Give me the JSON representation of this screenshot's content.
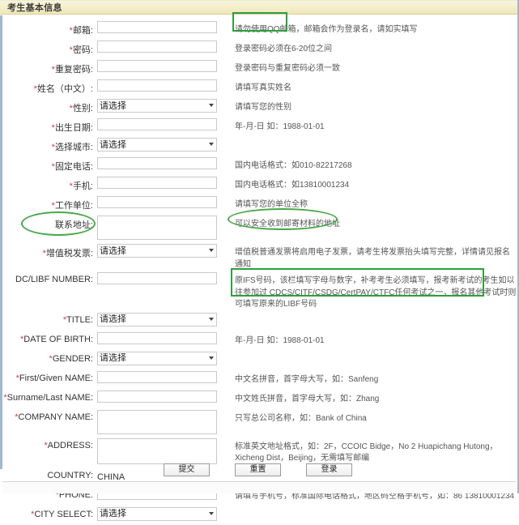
{
  "panel": {
    "title": "考生基本信息"
  },
  "placeholder_select": "请选择",
  "colors": {
    "annotation_green": "#2f9e3f",
    "header_bg": "#f4eec9",
    "required_star": "#d04040"
  },
  "fields": [
    {
      "label": "*邮箱:",
      "required": true,
      "type": "text",
      "value": "",
      "hint": "请勿使用QQ邮箱，邮箱会作为登录名，请如实填写",
      "hint_highlight": "box"
    },
    {
      "label": "*密码:",
      "required": true,
      "type": "text",
      "value": "",
      "hint": "登录密码必须在6-20位之间"
    },
    {
      "label": "*重复密码:",
      "required": true,
      "type": "text",
      "value": "",
      "hint": "登录密码与重复密码必须一致"
    },
    {
      "label": "*姓名（中文）:",
      "required": true,
      "type": "text",
      "value": "",
      "hint": "请填写真实姓名"
    },
    {
      "label": "*性别:",
      "required": true,
      "type": "select",
      "value": "请选择",
      "hint": "请填写您的性别"
    },
    {
      "label": "*出生日期:",
      "required": true,
      "type": "text",
      "value": "",
      "hint": "年-月-日 如：1988-01-01"
    },
    {
      "label": "*选择城市:",
      "required": true,
      "type": "select",
      "value": "请选择",
      "hint": ""
    },
    {
      "label": "*固定电话:",
      "required": true,
      "type": "text",
      "value": "",
      "hint": "国内电话格式：如010-82217268"
    },
    {
      "label": "*手机:",
      "required": true,
      "type": "text",
      "value": "",
      "hint": "国内电话格式：如13810001234"
    },
    {
      "label": "*工作单位:",
      "required": true,
      "type": "text",
      "value": "",
      "hint": "请填写您的单位全称"
    },
    {
      "label": "联系地址:",
      "required": false,
      "type": "textarea",
      "value": "",
      "hint": "可以安全收到邮寄材料的地址",
      "label_highlight": "ellipse",
      "hint_highlight": "ellipse"
    },
    {
      "label": "*增值税发票:",
      "required": true,
      "type": "select",
      "value": "请选择",
      "hint": "增值税普通发票将启用电子发票，请考生将发票抬头填写完整，详情请见报名通知"
    },
    {
      "label": "DC/LIBF NUMBER:",
      "required": false,
      "type": "text",
      "value": "",
      "hint": "原IFS号码，该栏填写字母与数字，补考考生必须填写，报考新考试的考生如以往参加过 CDCS/CITF/CSDG/CertPAY/CTFC任何考试之一，报名其他考试时则可填写原来的LIBF号码",
      "hint_highlight": "box"
    },
    {
      "label": "*TITLE:",
      "required": true,
      "type": "select",
      "value": "请选择",
      "hint": ""
    },
    {
      "label": "*DATE OF BIRTH:",
      "required": true,
      "type": "text",
      "value": "",
      "hint": "年-月-日 如：1988-01-01"
    },
    {
      "label": "*GENDER:",
      "required": true,
      "type": "select",
      "value": "请选择",
      "hint": ""
    },
    {
      "label": "*First/Given NAME:",
      "required": true,
      "type": "text",
      "value": "",
      "hint": "中文名拼音，首字母大写，如：Sanfeng"
    },
    {
      "label": "*Surname/Last NAME:",
      "required": true,
      "type": "text",
      "value": "",
      "hint": "中文姓氏拼音，首字母大写，如：Zhang"
    },
    {
      "label": "*COMPANY NAME:",
      "required": true,
      "type": "textarea",
      "value": "",
      "hint": "只写总公司名称，如：Bank of China"
    },
    {
      "label": "*ADDRESS:",
      "required": true,
      "type": "textarea",
      "value": "",
      "hint": "标准英文地址格式，如：2F，CCOIC Bidge，No 2 Huapichang Hutong，Xicheng Dist，Beijing，无需填写邮编"
    },
    {
      "label": "COUNTRY:",
      "required": false,
      "type": "static",
      "value": "CHINA",
      "hint": ""
    },
    {
      "label": "*PHONE:",
      "required": true,
      "type": "text",
      "value": "",
      "hint": "请填写手机号，标准国际电话格式，地区码空格手机号，如：86 13810001234"
    },
    {
      "label": "*CITY SELECT:",
      "required": true,
      "type": "select",
      "value": "请选择",
      "hint": ""
    }
  ],
  "buttons": [
    {
      "label": "提交",
      "name": "submit-button"
    },
    {
      "label": "重置",
      "name": "reset-button"
    },
    {
      "label": "登录",
      "name": "login-button"
    }
  ]
}
